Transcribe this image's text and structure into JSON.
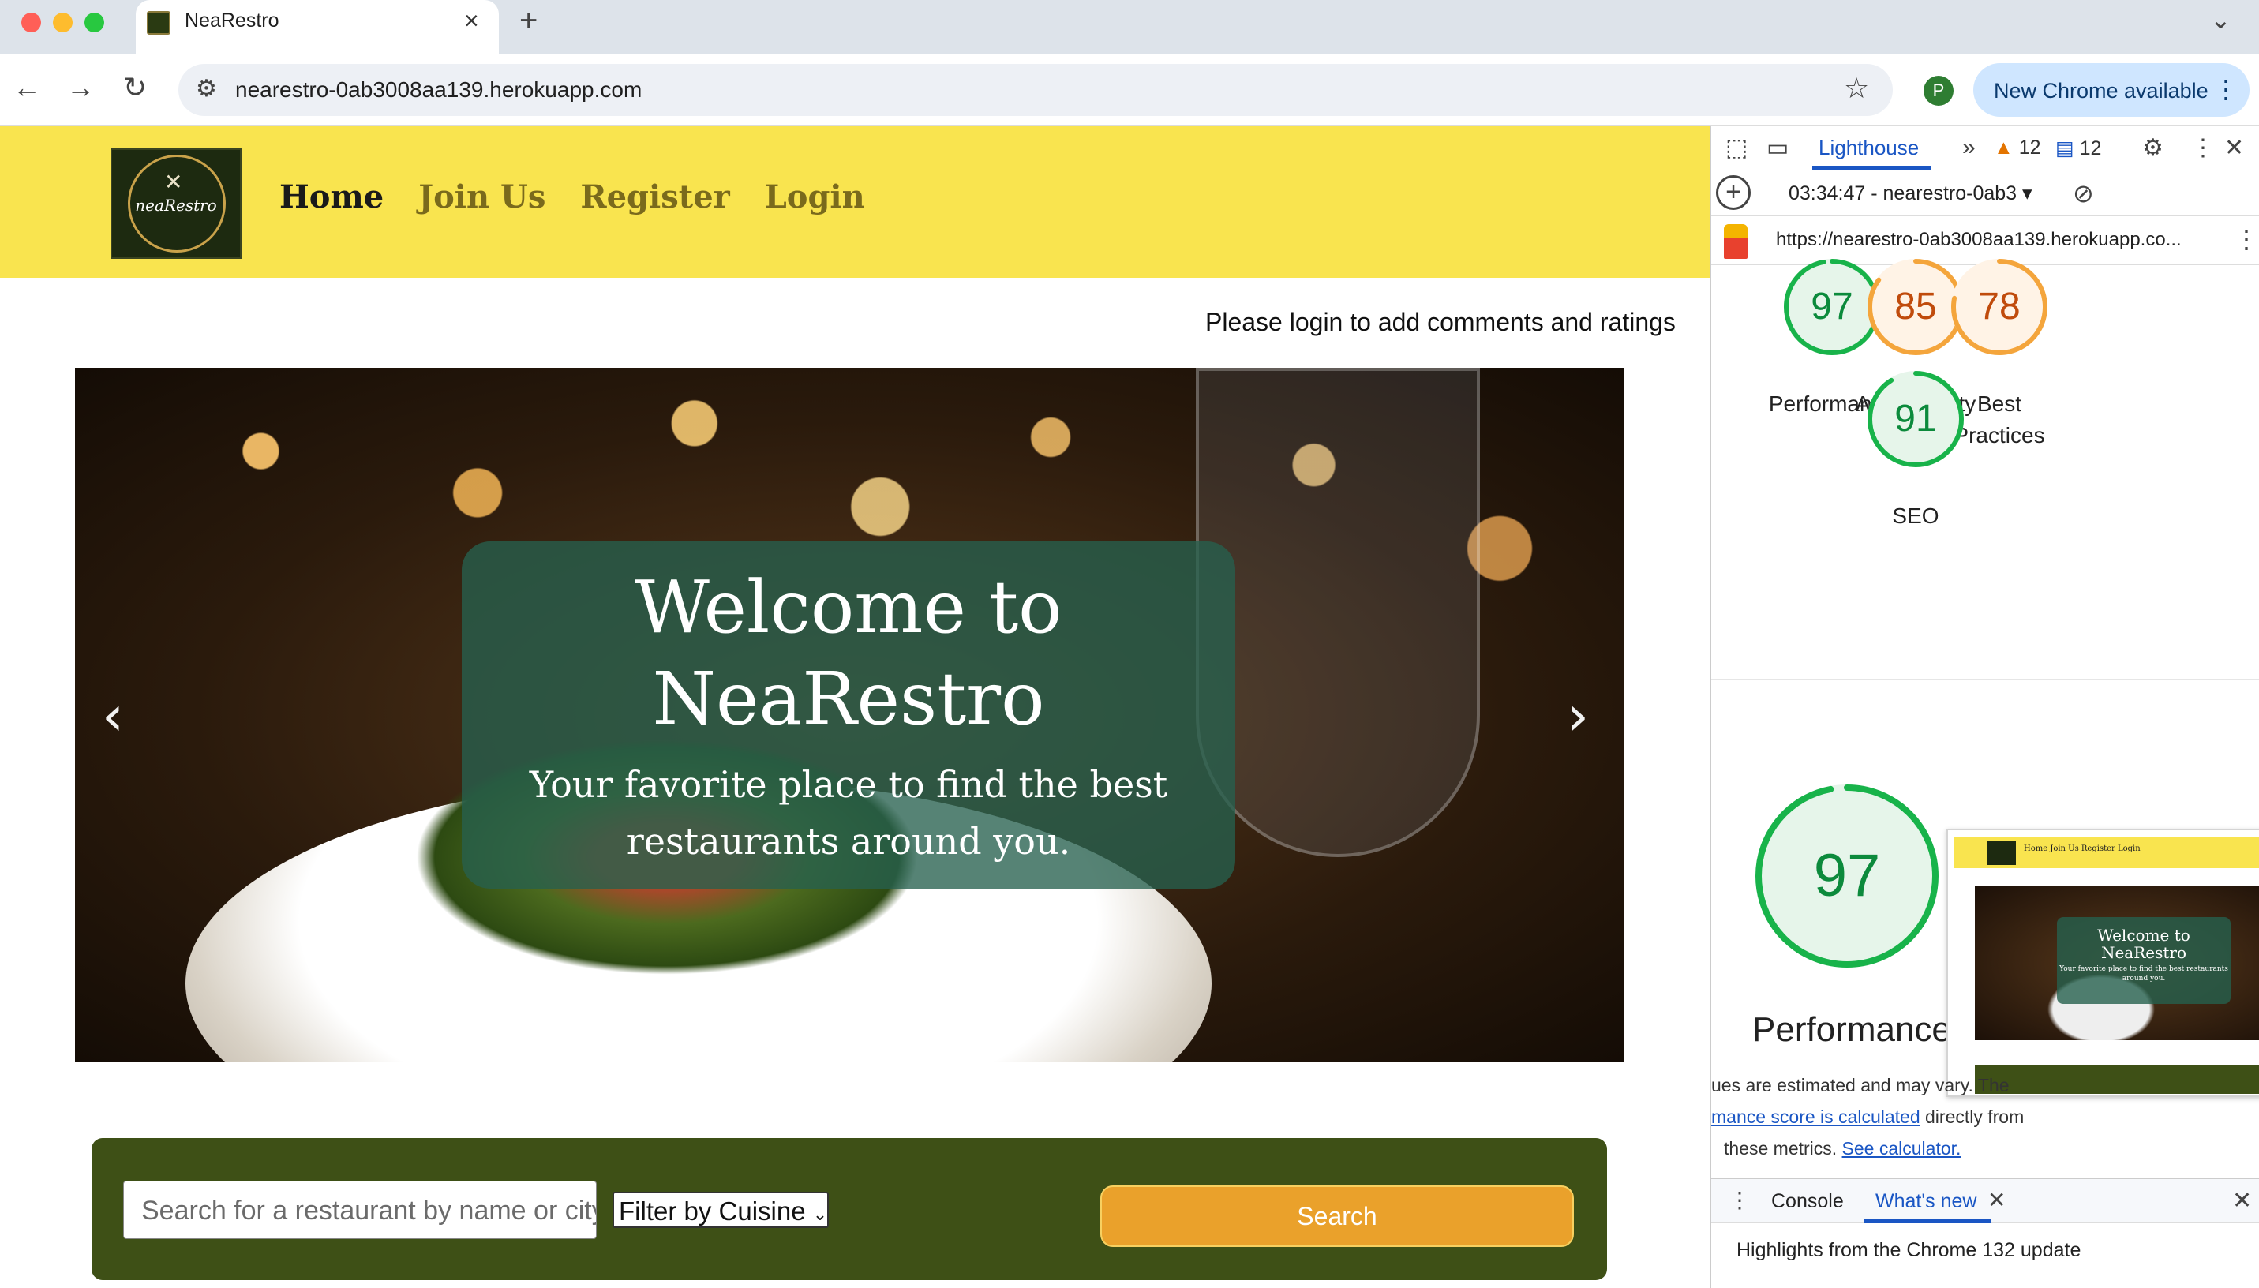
{
  "browser": {
    "tab_title": "NeaRestro",
    "tab_close": "×",
    "new_tab": "+",
    "url": "nearestro-0ab3008aa139.herokuapp.com",
    "update_label": "New Chrome available",
    "profile_initial": "P"
  },
  "site": {
    "logo_text": "neaRestro",
    "nav": {
      "home": "Home",
      "join": "Join Us",
      "register": "Register",
      "login": "Login"
    },
    "login_note": "Please login to add comments and ratings",
    "hero": {
      "title": "Welcome to NeaRestro",
      "subtitle": "Your favorite place to find the best restaurants around you.",
      "prev": "‹",
      "next": "›"
    },
    "search": {
      "placeholder": "Search for a restaurant by name or city",
      "cuisine_selected": "Filter by Cuisine",
      "button": "Search"
    }
  },
  "devtools": {
    "active_tab": "Lighthouse",
    "more_tabs": "»",
    "warnings": "12",
    "messages": "12",
    "report_selector": "03:34:47 - nearestro-0ab3",
    "report_url": "https://nearestro-0ab3008aa139.herokuapp.co...",
    "scores": [
      {
        "label": "Performance",
        "value": 97,
        "color": "#0c8a3c"
      },
      {
        "label": "Accessibility",
        "value": 85,
        "color": "#c04b0c"
      },
      {
        "label": "Best Practices",
        "value": 78,
        "color": "#c04b0c"
      },
      {
        "label": "SEO",
        "value": 91,
        "color": "#0c8a3c"
      }
    ],
    "big_score": {
      "label": "Performance",
      "value": 97
    },
    "thumb": {
      "nav": "Home   Join Us   Register   Login",
      "title": "Welcome to NeaRestro",
      "subtitle": "Your favorite place to find the best restaurants around you."
    },
    "note_line1": "ues are estimated and may vary. The",
    "note_link1": "mance score is calculated",
    "note_line2_rest": " directly from",
    "note_line3": "these metrics. ",
    "note_link2": "See calculator.",
    "drawer": {
      "console": "Console",
      "whats_new": "What's new",
      "highlight": "Highlights from the Chrome 132 update"
    }
  }
}
